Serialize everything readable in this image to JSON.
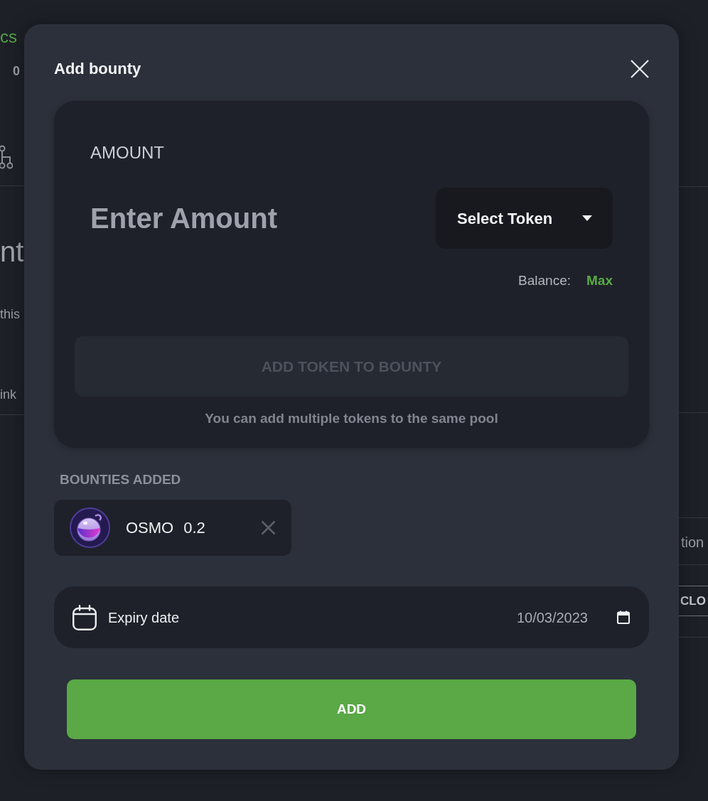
{
  "page_behind": {
    "left": {
      "heading_fragment": "cs",
      "count": "0",
      "title_fragment": "nt",
      "text_fragment_1": "this",
      "text_fragment_2": "ink"
    },
    "right": {
      "text_fragment": "tion",
      "button_fragment": "CLO"
    }
  },
  "modal": {
    "title": "Add bounty",
    "amount": {
      "label": "AMOUNT",
      "placeholder": "Enter Amount",
      "token_select": "Select Token",
      "balance_label": "Balance:",
      "max_link": "Max",
      "add_token_button": {
        "label": "ADD TOKEN TO BOUNTY",
        "disabled": true
      },
      "hint": "You can add multiple tokens to the same pool"
    },
    "bounties_added": {
      "heading": "BOUNTIES ADDED",
      "items": [
        {
          "token": "OSMO",
          "amount": "0.2"
        }
      ]
    },
    "expiry": {
      "label": "Expiry date",
      "value": "10/03/2023"
    },
    "submit_button": "ADD"
  }
}
